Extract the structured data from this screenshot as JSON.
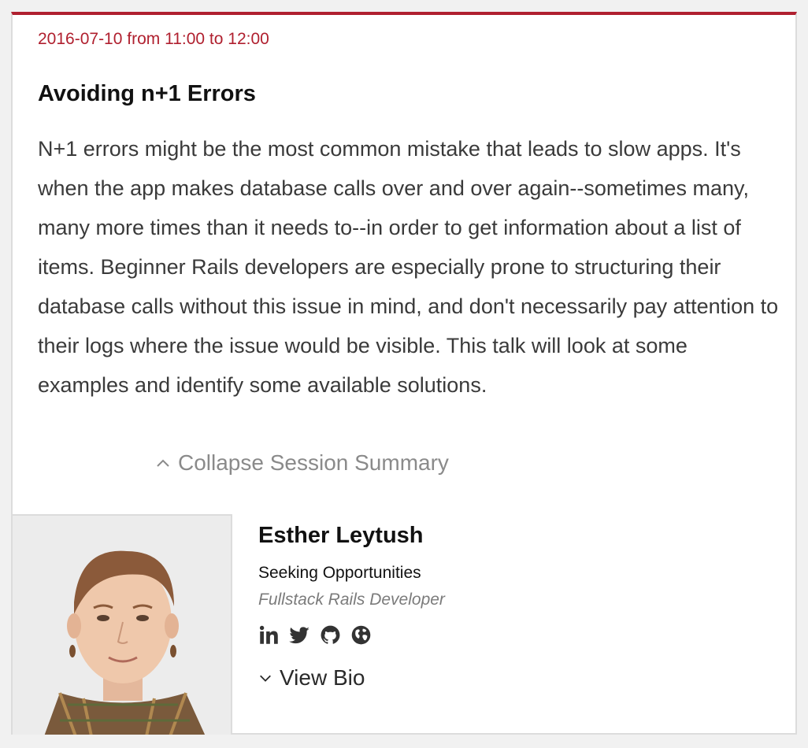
{
  "session": {
    "datetime": "2016-07-10 from 11:00 to 12:00",
    "title": "Avoiding n+1 Errors",
    "summary": "N+1 errors might be the most common mistake that leads to slow apps. It's when the app makes database calls over and over again--sometimes many, many more times than it needs to--in order to get information about a list of items. Beginner Rails developers are especially prone to structuring their database calls without this issue in mind, and don't necessarily pay attention to their logs where the issue would be visible. This talk will look at some examples and identify some available solutions.",
    "collapse_label": "Collapse Session Summary"
  },
  "speaker": {
    "name": "Esther Leytush",
    "company": "Seeking Opportunities",
    "role": "Fullstack Rails Developer",
    "view_bio_label": "View Bio",
    "social_icons": [
      "linkedin-icon",
      "twitter-icon",
      "github-icon",
      "globe-icon"
    ]
  },
  "colors": {
    "accent": "#b0202f",
    "text": "#111111",
    "body_text": "#3a3a3a",
    "muted": "#8a8a8a"
  }
}
